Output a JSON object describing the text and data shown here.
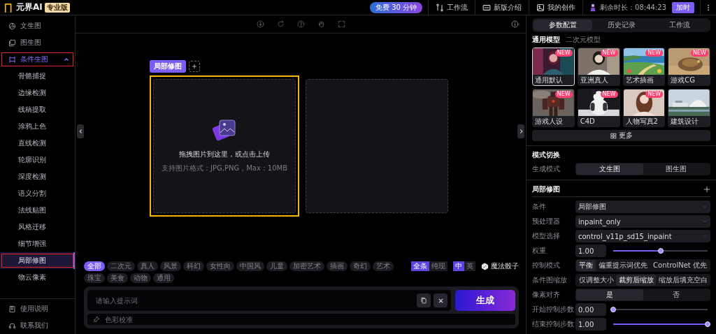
{
  "app": {
    "logo_text": "元界AI",
    "edition_badge": "专业版"
  },
  "top_bar": {
    "promo": "免费 30 分钟",
    "links": [
      {
        "label": "工作流"
      },
      {
        "label": "新版介绍"
      },
      {
        "label": "我的创作"
      }
    ],
    "remaining": "剩余时长：08:44:23",
    "extend_button": "加时"
  },
  "sidebar": {
    "items": [
      {
        "label": "文生图",
        "selected": false,
        "outlined": false
      },
      {
        "label": "图生图",
        "selected": false,
        "outlined": false
      },
      {
        "label": "条件生图",
        "selected": true,
        "outlined": true,
        "expanded": true,
        "children": [
          {
            "label": "骨骼捕捉",
            "selected": false,
            "outlined": false
          },
          {
            "label": "边缘检测",
            "selected": false,
            "outlined": false
          },
          {
            "label": "线稿提取",
            "selected": false,
            "outlined": false
          },
          {
            "label": "涂鸦上色",
            "selected": false,
            "outlined": false
          },
          {
            "label": "直线检测",
            "selected": false,
            "outlined": false
          },
          {
            "label": "轮廓识别",
            "selected": false,
            "outlined": false
          },
          {
            "label": "深度检测",
            "selected": false,
            "outlined": false
          },
          {
            "label": "语义分割",
            "selected": false,
            "outlined": false
          },
          {
            "label": "法线贴图",
            "selected": false,
            "outlined": false
          },
          {
            "label": "风格迁移",
            "selected": false,
            "outlined": false
          },
          {
            "label": "细节增强",
            "selected": false,
            "outlined": false
          },
          {
            "label": "局部修图",
            "selected": true,
            "outlined": true
          },
          {
            "label": "物云像素",
            "selected": false,
            "outlined": false
          }
        ]
      }
    ],
    "footer": [
      {
        "label": "使用说明"
      },
      {
        "label": "联系我们"
      }
    ]
  },
  "canvas": {
    "tabs": [
      {
        "label": "局部修图",
        "selected": true
      }
    ],
    "panels": [
      {
        "kind": "upload",
        "selected": true,
        "title": "拖拽图片到这里，或点击上传",
        "hint": "支持图片格式：JPG,PNG，Max：10MB"
      },
      {
        "kind": "result",
        "selected": false
      }
    ]
  },
  "tags": [
    {
      "label": "全部",
      "selected": true
    },
    {
      "label": "二次元",
      "selected": false
    },
    {
      "label": "真人",
      "selected": false
    },
    {
      "label": "风景",
      "selected": false
    },
    {
      "label": "科幻",
      "selected": false
    },
    {
      "label": "女性向",
      "selected": false
    },
    {
      "label": "中国风",
      "selected": false
    },
    {
      "label": "儿童",
      "selected": false
    },
    {
      "label": "加密艺术",
      "selected": false
    },
    {
      "label": "插画",
      "selected": false
    },
    {
      "label": "奇幻",
      "selected": false
    },
    {
      "label": "艺术",
      "selected": false
    },
    {
      "label": "珠宝",
      "selected": false
    },
    {
      "label": "美食",
      "selected": false
    },
    {
      "label": "动物",
      "selected": false
    },
    {
      "label": "通用",
      "selected": false
    }
  ],
  "toggles": [
    {
      "options": [
        {
          "label": "全条",
          "selected": true
        },
        {
          "label": "纯现",
          "selected": false
        }
      ]
    },
    {
      "options": [
        {
          "label": "中",
          "selected": true
        },
        {
          "label": "英",
          "selected": false
        }
      ]
    }
  ],
  "dice_button": "魔法骰子",
  "prompt": {
    "placeholder": "请输入提示词",
    "generate_button": "生成",
    "secondary_placeholder": "色彩校准"
  },
  "right_panel": {
    "tabs": [
      {
        "label": "参数配置",
        "selected": true
      },
      {
        "label": "历史记录",
        "selected": false
      },
      {
        "label": "工作流",
        "selected": false
      }
    ],
    "model_tabs": [
      {
        "label": "通用模型",
        "selected": true
      },
      {
        "label": "二次元模型",
        "selected": false
      }
    ],
    "models": [
      {
        "label": "通用默认",
        "badge": "NEW",
        "selected": true
      },
      {
        "label": "亚洲真人",
        "badge": "NEW",
        "selected": false
      },
      {
        "label": "艺术插画",
        "badge": "NEW",
        "selected": false
      },
      {
        "label": "游戏CG",
        "badge": "NEW",
        "selected": false
      },
      {
        "label": "游戏人设",
        "badge": "NEW",
        "selected": false
      },
      {
        "label": "C4D",
        "badge": "NEW",
        "selected": false
      },
      {
        "label": "人物写真2",
        "badge": "NEW",
        "selected": false
      },
      {
        "label": "建筑设计",
        "selected": false
      }
    ],
    "more_button": "更多",
    "mode": {
      "title": "模式切换",
      "label": "生成模式",
      "options": [
        {
          "label": "文生图",
          "selected": true
        },
        {
          "label": "图生图",
          "selected": false
        }
      ]
    },
    "control": {
      "title": "局部修图",
      "rows": [
        {
          "kind": "select",
          "label": "条件",
          "value": "局部修图"
        },
        {
          "kind": "select",
          "label": "预处理器",
          "value": "inpaint_only"
        },
        {
          "kind": "select",
          "label": "模型选择",
          "value": "control_v11p_sd15_inpaint"
        },
        {
          "kind": "slider",
          "label": "权重",
          "value": "1.00",
          "level": 0.5
        },
        {
          "kind": "segmented",
          "label": "控制模式",
          "options": [
            {
              "label": "平衡",
              "selected": true
            },
            {
              "label": "偏重提示词优先",
              "selected": false
            },
            {
              "label": "ControlNet 优先",
              "selected": false
            }
          ]
        },
        {
          "kind": "segmented",
          "label": "条件图缩放",
          "options": [
            {
              "label": "仅调整大小",
              "selected": false
            },
            {
              "label": "裁剪后缩放",
              "selected": true
            },
            {
              "label": "缩放后填充空白",
              "selected": false
            }
          ]
        },
        {
          "kind": "segmented",
          "label": "像素对齐",
          "options": [
            {
              "label": "是",
              "selected": true
            },
            {
              "label": "否",
              "selected": false
            }
          ]
        },
        {
          "kind": "slider",
          "label": "开始控制步数",
          "value": "0.00",
          "level": 0
        },
        {
          "kind": "slider",
          "label": "结束控制步数",
          "value": "1.00",
          "level": 1
        }
      ]
    }
  }
}
